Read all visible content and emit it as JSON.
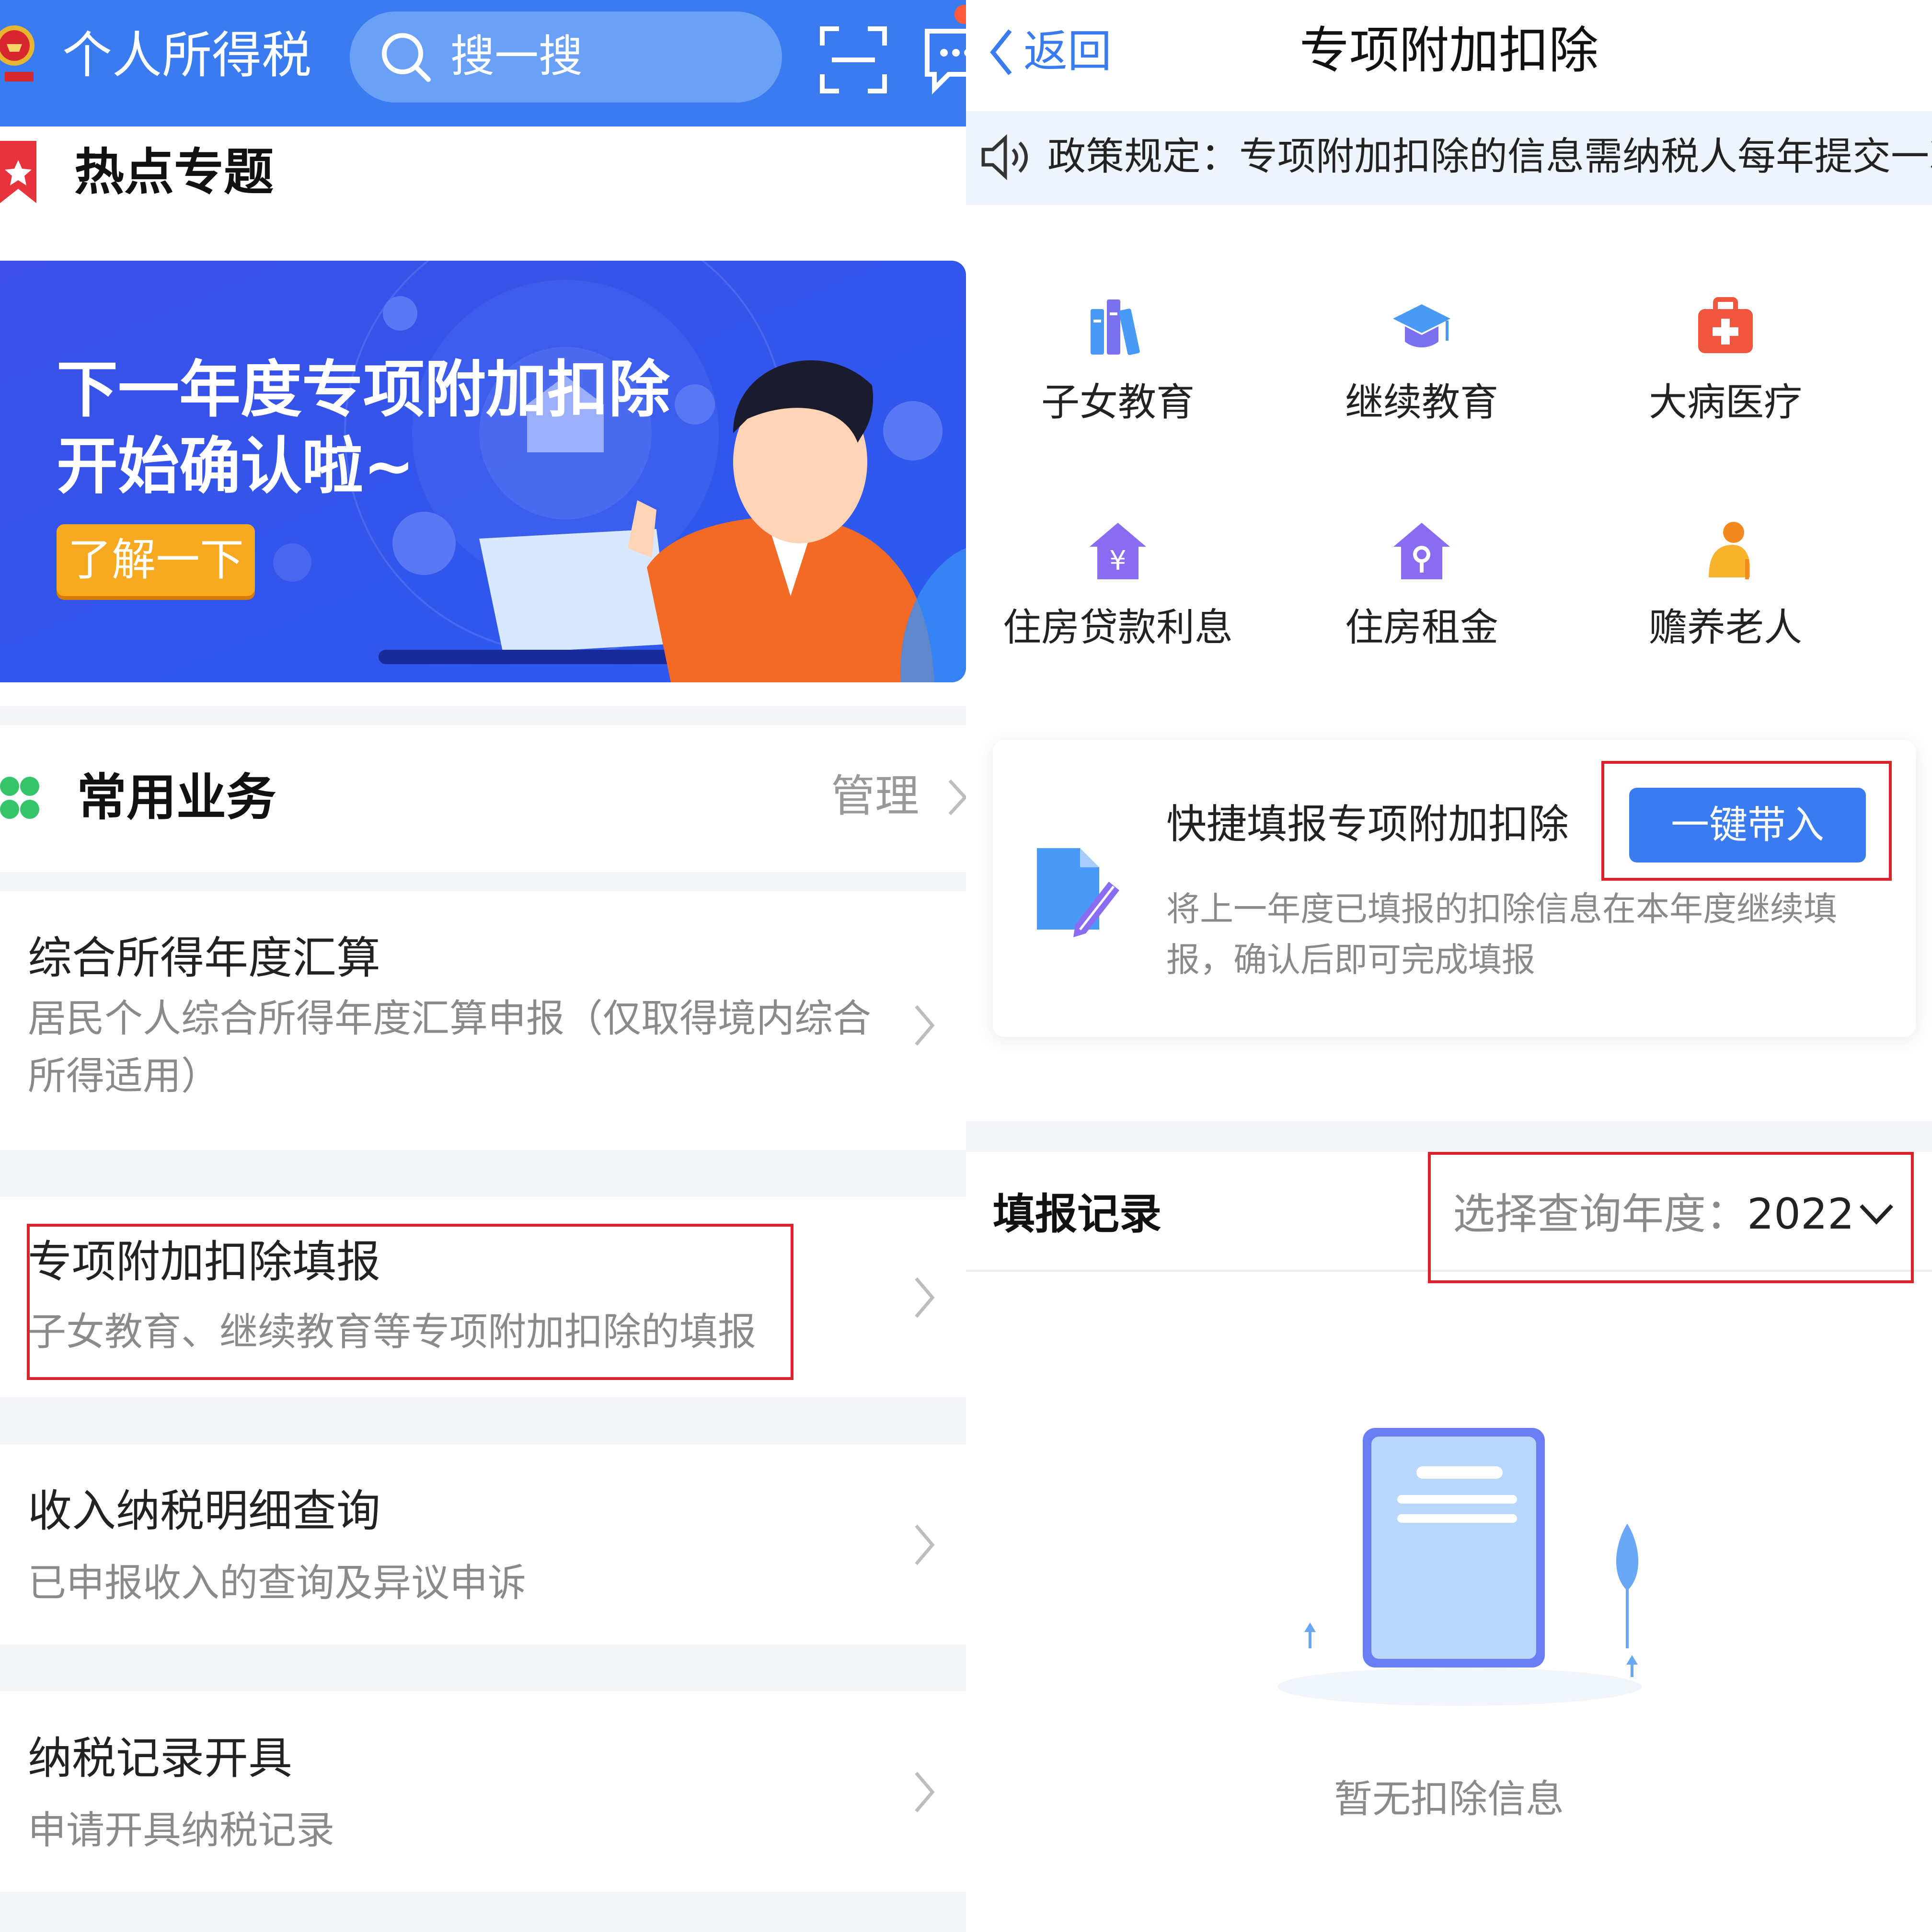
{
  "left": {
    "header": {
      "app_title": "个人所得税",
      "search_placeholder": "搜一搜"
    },
    "hot": {
      "section_title": "热点专题",
      "banner": {
        "line1": "下一年度专项附加扣除",
        "line2": "开始确认啦~",
        "button": "了解一下"
      }
    },
    "common": {
      "section_title": "常用业务",
      "manage_label": "管理",
      "items": [
        {
          "title": "综合所得年度汇算",
          "subtitle": "居民个人综合所得年度汇算申报（仅取得境内综合所得适用）"
        },
        {
          "title": "专项附加扣除填报",
          "subtitle": "子女教育、继续教育等专项附加扣除的填报"
        },
        {
          "title": "收入纳税明细查询",
          "subtitle": "已申报收入的查询及异议申诉"
        },
        {
          "title": "纳税记录开具",
          "subtitle": "申请开具纳税记录"
        }
      ]
    }
  },
  "right": {
    "nav": {
      "back_label": "返回",
      "title": "专项附加扣除"
    },
    "notice": "政策规定：专项附加扣除的信息需纳税人每年提交一次",
    "categories": [
      {
        "label": "子女教育",
        "icon": "books-icon"
      },
      {
        "label": "继续教育",
        "icon": "graduation-cap-icon"
      },
      {
        "label": "大病医疗",
        "icon": "medical-kit-icon"
      },
      {
        "label": "住房贷款利息",
        "icon": "house-yen-icon"
      },
      {
        "label": "住房租金",
        "icon": "house-key-icon"
      },
      {
        "label": "赡养老人",
        "icon": "elderly-person-icon"
      }
    ],
    "quick_fill": {
      "title": "快捷填报专项附加扣除",
      "button": "一键带入",
      "description": "将上一年度已填报的扣除信息在本年度继续填报，确认后即可完成填报"
    },
    "records": {
      "title": "填报记录",
      "year_label": "选择查询年度：",
      "year_value": "2022",
      "empty_text": "暂无扣除信息"
    }
  },
  "colors": {
    "brand_blue": "#3a7bef",
    "highlight_red": "#d9232d",
    "banner_orange": "#f7a821"
  }
}
